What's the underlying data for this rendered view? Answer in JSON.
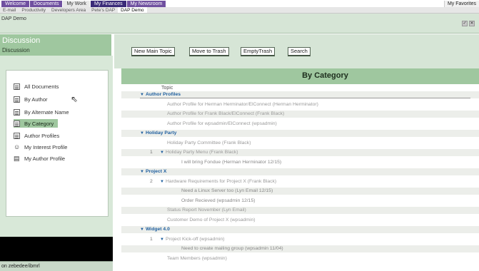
{
  "top_tabs": [
    {
      "label": "Welcome",
      "style": "normal"
    },
    {
      "label": "Documents",
      "style": "normal"
    },
    {
      "label": "My Work",
      "style": "active"
    },
    {
      "label": "My Finances",
      "style": "dark"
    },
    {
      "label": "My Newsroom",
      "style": "normal"
    }
  ],
  "favorites_label": "My Favorites",
  "sub_tabs": [
    {
      "label": "E-mail",
      "active": false
    },
    {
      "label": "Productivity",
      "active": false
    },
    {
      "label": "Developers Area",
      "active": false
    },
    {
      "label": "Pete's DAP",
      "active": false
    },
    {
      "label": "DAP Demo",
      "active": true
    }
  ],
  "app": {
    "title": "DAP Demo",
    "tool_icons": [
      "check-icon",
      "close-icon"
    ]
  },
  "sidebar": {
    "title": "Discussion",
    "subtitle": "Discussion",
    "items": [
      {
        "label": "All Documents",
        "icon": "view-icon",
        "selected": false
      },
      {
        "label": "By Author",
        "icon": "view-icon",
        "selected": false
      },
      {
        "label": "By Alternate Name",
        "icon": "view-icon",
        "selected": false
      },
      {
        "label": "By Category",
        "icon": "view-icon",
        "selected": true
      },
      {
        "label": "Author Profiles",
        "icon": "view-icon",
        "selected": false
      },
      {
        "label": "My Interest Profile",
        "icon": "interest-icon",
        "selected": false
      },
      {
        "label": "My Author Profile",
        "icon": "profile-icon",
        "selected": false
      }
    ]
  },
  "status_text": "on zebedee/ibmrl",
  "actions": [
    "New Main Topic",
    "Move to Trash",
    "EmptyTrash",
    "Search"
  ],
  "view": {
    "title": "By Category",
    "column_header": "Topic",
    "rows": [
      {
        "type": "cat",
        "text": "Author Profiles",
        "indent": 26,
        "count": ""
      },
      {
        "type": "doc",
        "text": "Author Profile for Herman Herminator/ElConnect (Herman Herminator)",
        "indent": 64,
        "count": ""
      },
      {
        "type": "doc",
        "text": "Author Profile for Frank Black/ElConnect (Frank Black)",
        "indent": 64,
        "count": ""
      },
      {
        "type": "doc",
        "text": "Author Profile for wpsadmin/ElConnect (wpsadmin)",
        "indent": 64,
        "count": ""
      },
      {
        "type": "cat",
        "text": "Holiday Party",
        "indent": 26,
        "count": ""
      },
      {
        "type": "doc",
        "text": "Holiday Party Committee (Frank Black)",
        "indent": 64,
        "count": ""
      },
      {
        "type": "doc",
        "text": "Holiday Party Menu (Frank Black)",
        "indent": 54,
        "twisty": true,
        "count": "1"
      },
      {
        "type": "child",
        "text": "I will bring Fondue (Herman Herminator 12/15)",
        "indent": 84,
        "count": ""
      },
      {
        "type": "cat",
        "text": "Project X",
        "indent": 26,
        "count": ""
      },
      {
        "type": "doc",
        "text": "Hardware Requirements for Project X (Frank Black)",
        "indent": 54,
        "twisty": true,
        "count": "2"
      },
      {
        "type": "child",
        "text": "Need a Linux Server too (Lyn Email 12/15)",
        "indent": 84,
        "count": ""
      },
      {
        "type": "child",
        "text": "Order Recieved (wpsadmin 12/15)",
        "indent": 84,
        "count": ""
      },
      {
        "type": "doc",
        "text": "Status Report November (Lyn Email)",
        "indent": 64,
        "count": ""
      },
      {
        "type": "doc",
        "text": "Customer Demo of Project X (wpsadmin)",
        "indent": 64,
        "count": ""
      },
      {
        "type": "cat",
        "text": "Widget 4.0",
        "indent": 26,
        "count": ""
      },
      {
        "type": "doc",
        "text": "Project Kick-off (wpsadmin)",
        "indent": 54,
        "twisty": true,
        "count": "1"
      },
      {
        "type": "child",
        "text": "Need to create mailing group (wpsadmin 11/04)",
        "indent": 84,
        "count": ""
      },
      {
        "type": "doc",
        "text": "Team Members (wpsadmin)",
        "indent": 64,
        "count": ""
      }
    ]
  },
  "colors": {
    "purple_tab": "#7050a0",
    "green_header": "#9fc79f",
    "light_green": "#d6e5d6",
    "category_blue": "#1f5f9f"
  }
}
